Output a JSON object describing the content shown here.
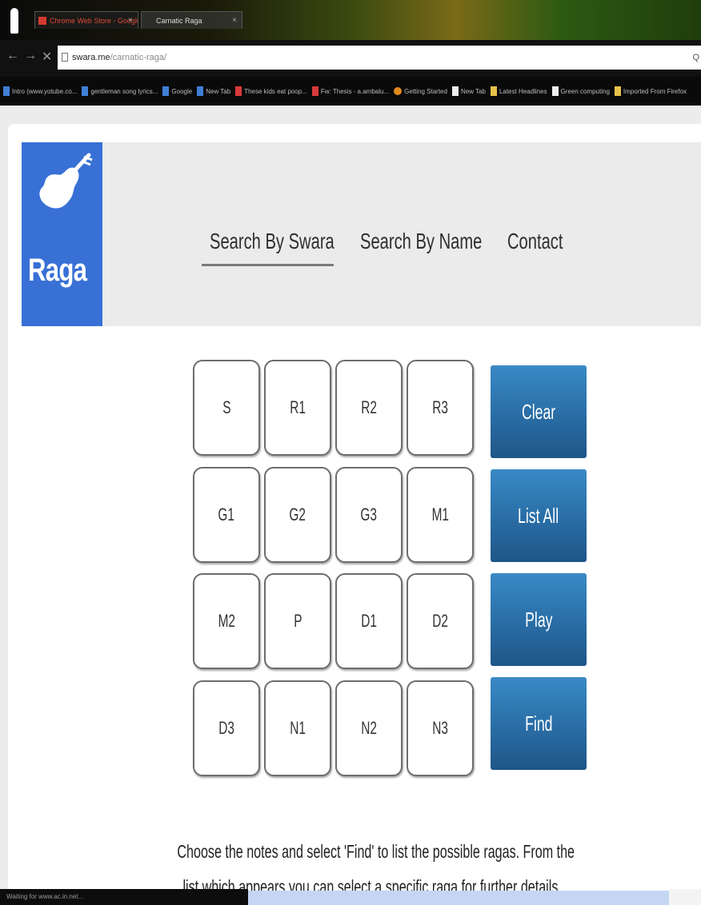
{
  "browser": {
    "tabs": [
      {
        "label": "Chrome Web Store - Google",
        "active": false
      },
      {
        "label": "Carnatic Raga",
        "active": true
      }
    ],
    "address": {
      "domain": "swara.me",
      "path": "/carnatic-raga/"
    },
    "address_right_icon": "zoom-icon",
    "bookmarks": [
      {
        "label": "Intro (www.yotube.co...",
        "icon": "google-icon"
      },
      {
        "label": "gentleman song lyrics...",
        "icon": "google-icon"
      },
      {
        "label": "Google",
        "icon": "google-icon"
      },
      {
        "label": "New Tab",
        "icon": "google-icon"
      },
      {
        "label": "These kids eat poop...",
        "icon": "video-icon"
      },
      {
        "label": "Fw: Thesis - a.ambalu...",
        "icon": "mail-icon"
      },
      {
        "label": "Getting Started",
        "icon": "firefox-icon"
      },
      {
        "label": "New Tab",
        "icon": "page-icon"
      },
      {
        "label": "Latest Headlines",
        "icon": "folder-icon"
      },
      {
        "label": "Green computing",
        "icon": "page-icon"
      },
      {
        "label": "Imported From Firefox",
        "icon": "folder-icon"
      }
    ],
    "status_text": "Waiting for www.ac.in.net..."
  },
  "site": {
    "logo_text": "Raga",
    "nav": {
      "search_by_swara": "Search By Swara",
      "search_by_name": "Search By Name",
      "contact": "Contact"
    },
    "active_nav": "search_by_swara"
  },
  "swara_grid": [
    [
      "S",
      "R1",
      "R2",
      "R3"
    ],
    [
      "G1",
      "G2",
      "G3",
      "M1"
    ],
    [
      "M2",
      "P",
      "D1",
      "D2"
    ],
    [
      "D3",
      "N1",
      "N2",
      "N3"
    ]
  ],
  "actions": {
    "clear": "Clear",
    "list_all": "List All",
    "play": "Play",
    "find": "Find"
  },
  "instructions": {
    "line1": "Choose the notes and select 'Find' to list the possible ragas. From the",
    "line2": "list which appears you can select a specific raga for further details."
  },
  "colors": {
    "logo_bg": "#3870d6",
    "action_button": "#2a6fa8",
    "header_bg": "#ebebeb"
  }
}
